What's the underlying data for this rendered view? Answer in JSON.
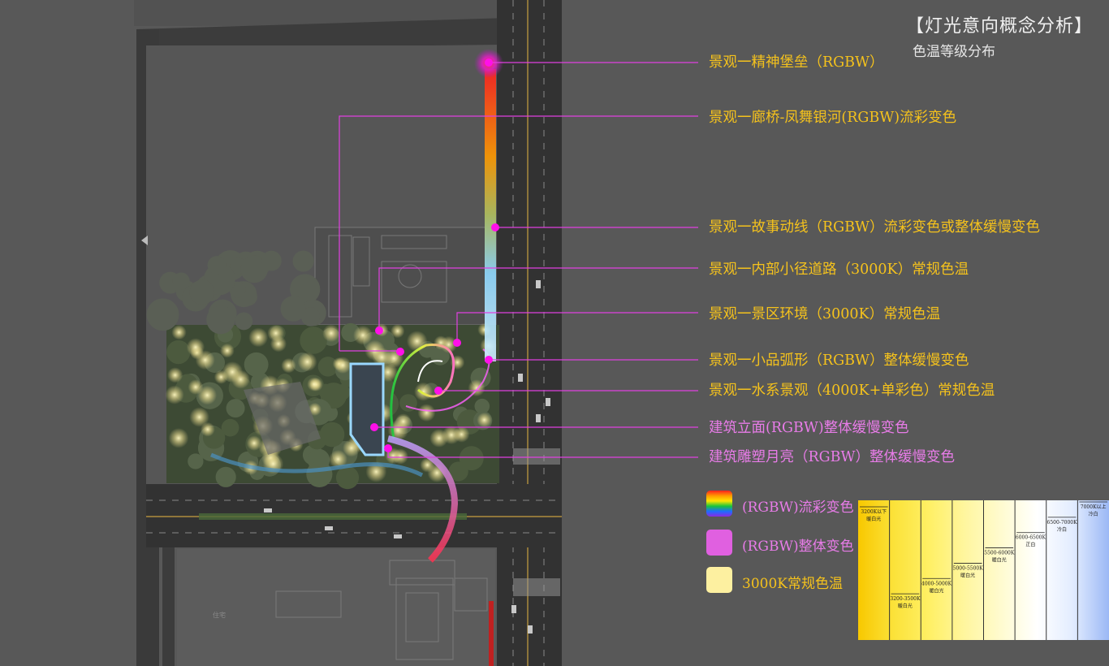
{
  "header": {
    "title": "【灯光意向概念分析】",
    "subtitle": "色温等级分布"
  },
  "colors": {
    "annotation_text": "#f5c21c",
    "annotation_text_building": "#e87ce8",
    "leader_line": "#e040e0",
    "marker": "#ff10e8",
    "rgbw_spectrum": [
      "#ff2020",
      "#ff9a00",
      "#ffe600",
      "#19c43c",
      "#1e6cff",
      "#8a2be2"
    ],
    "rgbw_whole": "#e060e0",
    "warm_3000k": "#fdf0a0"
  },
  "annotations": [
    {
      "text": "景观一精神堡垒（RGBW）",
      "category": "landscape"
    },
    {
      "text": "景观一廊桥-凤舞银河(RGBW)流彩变色",
      "category": "landscape"
    },
    {
      "text": "景观一故事动线（RGBW）流彩变色或整体缓慢变色",
      "category": "landscape"
    },
    {
      "text": "景观一内部小径道路（3000K）常规色温",
      "category": "landscape"
    },
    {
      "text": "景观一景区环境（3000K）常规色温",
      "category": "landscape"
    },
    {
      "text": "景观一小品弧形（RGBW）整体缓慢变色",
      "category": "landscape"
    },
    {
      "text": "景观一水系景观（4000K+单彩色）常规色温",
      "category": "landscape"
    },
    {
      "text": "建筑立面(RGBW)整体缓慢变色",
      "category": "building"
    },
    {
      "text": "建筑雕塑月亮（RGBW）整体缓慢变色",
      "category": "building"
    }
  ],
  "legend": [
    {
      "label": "(RGBW)流彩变色",
      "swatch": "rgbw_spectrum"
    },
    {
      "label": "(RGBW)整体变色",
      "swatch": "rgbw_whole"
    },
    {
      "label": "3000K常规色温",
      "swatch": "warm_3000k"
    }
  ],
  "color_temperature_scale": {
    "bands": [
      {
        "range": "3200K以下",
        "desc": "暖白光",
        "color": "#f8c800"
      },
      {
        "range": "3200-3500K",
        "desc": "暖白光",
        "color": "#fbe23a"
      },
      {
        "range": "4000-5000K",
        "desc": "暖白光",
        "color": "#fff066"
      },
      {
        "range": "5000-5500K",
        "desc": "暖白光",
        "color": "#fff6a0"
      },
      {
        "range": "5500-6000K",
        "desc": "暖白光",
        "color": "#fffbd0"
      },
      {
        "range": "6000-6500K",
        "desc": "正白",
        "color": "#ffffff"
      },
      {
        "range": "6500-7000K",
        "desc": "冷白",
        "color": "#e2ecff"
      },
      {
        "range": "7000K以上",
        "desc": "冷白",
        "color": "#9bb8f5"
      }
    ]
  },
  "map_labels": {
    "small_tag": "住宅"
  }
}
